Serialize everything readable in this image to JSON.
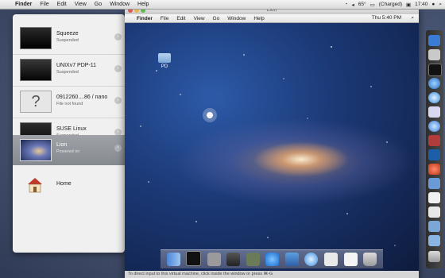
{
  "host_menubar": {
    "apple": "",
    "menus": [
      "Finder",
      "File",
      "Edit",
      "View",
      "Go",
      "Window",
      "Help"
    ],
    "temperature": "65°",
    "battery": "(Charged)",
    "clock": "17:40"
  },
  "library": {
    "vms": [
      {
        "name": "Squeeze",
        "status": "Suspended"
      },
      {
        "name": "UNIXv7 PDP-11",
        "status": "Suspended"
      },
      {
        "name": "0912260....86 / nano",
        "status": "File not found"
      },
      {
        "name": "SUSE Linux",
        "status": "Suspended"
      },
      {
        "name": "Lion",
        "status": "Powered on"
      }
    ],
    "home_label": "Home"
  },
  "guest": {
    "title": "Lion",
    "apple": "",
    "menus": [
      "Finder",
      "File",
      "Edit",
      "View",
      "Go",
      "Window",
      "Help"
    ],
    "clock": "Thu 5:40 PM",
    "desktop_icon_label": "PD",
    "status_text": "To direct input to this virtual machine, click inside the window or press ⌘-G"
  },
  "colors": {
    "accent": "#3b78d8",
    "selected_row": "#8f9399"
  }
}
